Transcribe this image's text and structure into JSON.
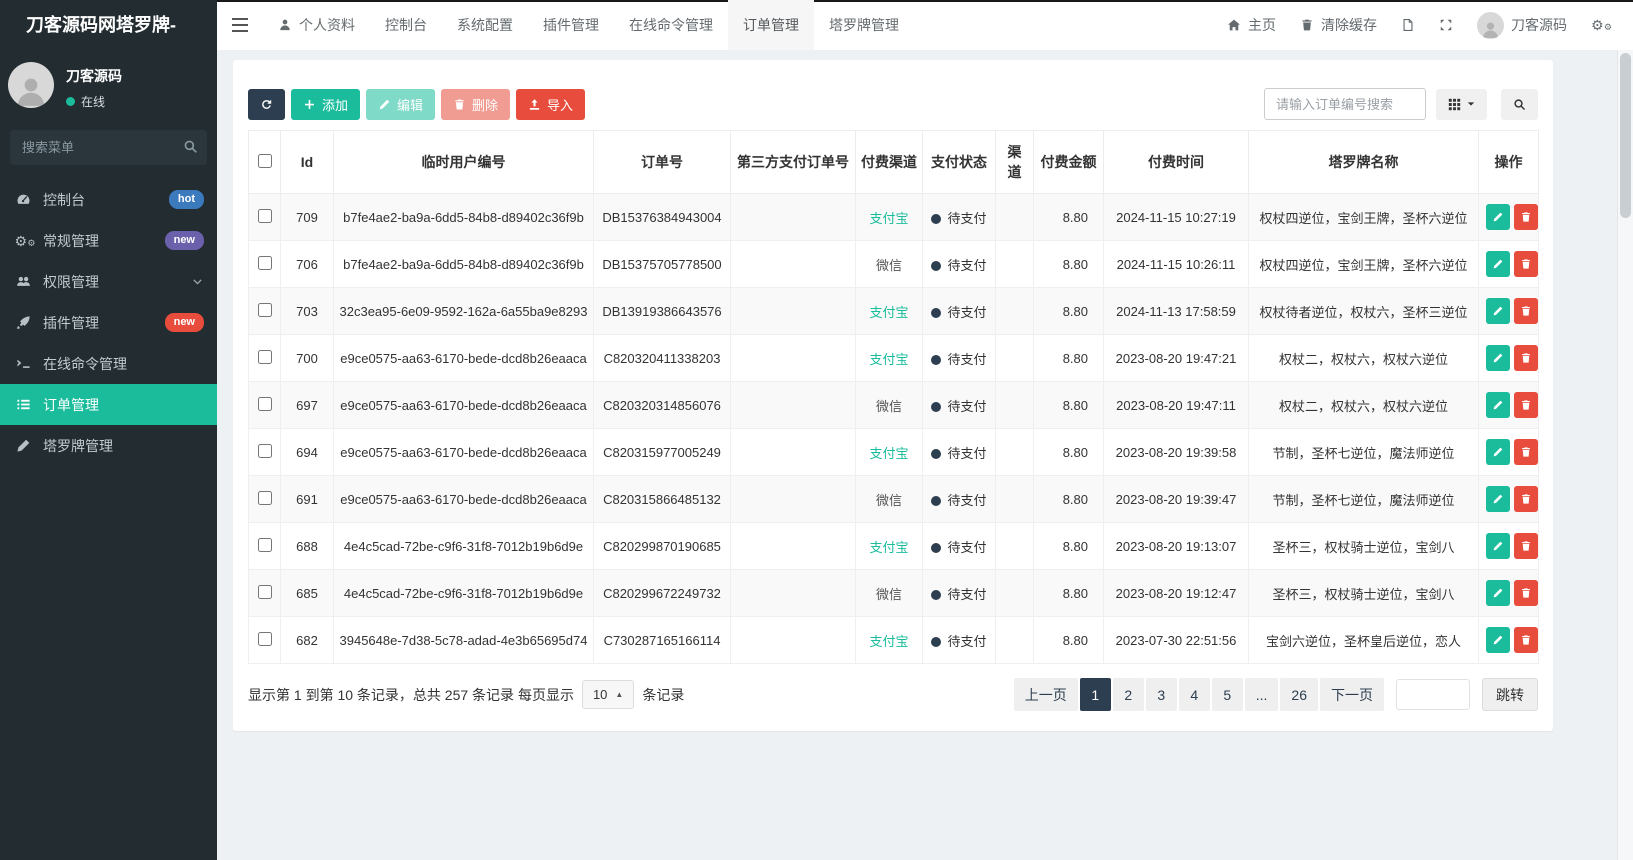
{
  "sidebar": {
    "brand": "刀客源码网塔罗牌-",
    "user": {
      "name": "刀客源码",
      "status": "在线"
    },
    "search_placeholder": "搜索菜单",
    "accent_color": "#1abc9c",
    "items": [
      {
        "label": "控制台",
        "icon": "dashboard-icon",
        "badge": "hot",
        "badge_color": "#3a7abd"
      },
      {
        "label": "常规管理",
        "icon": "gears-icon",
        "badge": "new",
        "badge_color": "#6b60ab"
      },
      {
        "label": "权限管理",
        "icon": "users-icon",
        "chevron": true
      },
      {
        "label": "插件管理",
        "icon": "rocket-icon",
        "badge": "new",
        "badge_color": "#e74c3c"
      },
      {
        "label": "在线命令管理",
        "icon": "terminal-icon"
      },
      {
        "label": "订单管理",
        "icon": "list-icon",
        "active": true
      },
      {
        "label": "塔罗牌管理",
        "icon": "pen-icon"
      }
    ]
  },
  "topnav": {
    "items": [
      {
        "label": "个人资料",
        "icon": "person-icon"
      },
      {
        "label": "控制台"
      },
      {
        "label": "系统配置"
      },
      {
        "label": "插件管理"
      },
      {
        "label": "在线命令管理"
      },
      {
        "label": "订单管理",
        "active": true
      },
      {
        "label": "塔罗牌管理"
      }
    ],
    "right": {
      "home": "主页",
      "clear_cache": "清除缓存",
      "username": "刀客源码"
    }
  },
  "toolbar": {
    "add_label": "添加",
    "edit_label": "编辑",
    "delete_label": "删除",
    "import_label": "导入",
    "search_placeholder": "请输入订单编号搜索"
  },
  "table": {
    "columns": [
      "Id",
      "临时用户编号",
      "订单号",
      "第三方支付订单号",
      "付费渠道",
      "支付状态",
      "渠道",
      "付费金额",
      "付费时间",
      "塔罗牌名称",
      "操作"
    ],
    "channel_colors": {
      "支付宝": "#1abc9c",
      "微信": "#555555"
    },
    "status_dot_color": "#2c3e50",
    "rows": [
      {
        "id": "709",
        "user_no": "b7fe4ae2-ba9a-6dd5-84b8-d89402c36f9b",
        "order_no": "DB15376384943004",
        "third_party_no": "",
        "channel": "支付宝",
        "status": "待支付",
        "qudao": "",
        "amount": "8.80",
        "time": "2024-11-15 10:27:19",
        "tarot": "权杖四逆位，宝剑王牌，圣杯六逆位"
      },
      {
        "id": "706",
        "user_no": "b7fe4ae2-ba9a-6dd5-84b8-d89402c36f9b",
        "order_no": "DB15375705778500",
        "third_party_no": "",
        "channel": "微信",
        "status": "待支付",
        "qudao": "",
        "amount": "8.80",
        "time": "2024-11-15 10:26:11",
        "tarot": "权杖四逆位，宝剑王牌，圣杯六逆位"
      },
      {
        "id": "703",
        "user_no": "32c3ea95-6e09-9592-162a-6a55ba9e8293",
        "order_no": "DB13919386643576",
        "third_party_no": "",
        "channel": "支付宝",
        "status": "待支付",
        "qudao": "",
        "amount": "8.80",
        "time": "2024-11-13 17:58:59",
        "tarot": "权杖待者逆位，权杖六，圣杯三逆位"
      },
      {
        "id": "700",
        "user_no": "e9ce0575-aa63-6170-bede-dcd8b26eaaca",
        "order_no": "C820320411338203",
        "third_party_no": "",
        "channel": "支付宝",
        "status": "待支付",
        "qudao": "",
        "amount": "8.80",
        "time": "2023-08-20 19:47:21",
        "tarot": "权杖二，权杖六，权杖六逆位"
      },
      {
        "id": "697",
        "user_no": "e9ce0575-aa63-6170-bede-dcd8b26eaaca",
        "order_no": "C820320314856076",
        "third_party_no": "",
        "channel": "微信",
        "status": "待支付",
        "qudao": "",
        "amount": "8.80",
        "time": "2023-08-20 19:47:11",
        "tarot": "权杖二，权杖六，权杖六逆位"
      },
      {
        "id": "694",
        "user_no": "e9ce0575-aa63-6170-bede-dcd8b26eaaca",
        "order_no": "C820315977005249",
        "third_party_no": "",
        "channel": "支付宝",
        "status": "待支付",
        "qudao": "",
        "amount": "8.80",
        "time": "2023-08-20 19:39:58",
        "tarot": "节制，圣杯七逆位，魔法师逆位"
      },
      {
        "id": "691",
        "user_no": "e9ce0575-aa63-6170-bede-dcd8b26eaaca",
        "order_no": "C820315866485132",
        "third_party_no": "",
        "channel": "微信",
        "status": "待支付",
        "qudao": "",
        "amount": "8.80",
        "time": "2023-08-20 19:39:47",
        "tarot": "节制，圣杯七逆位，魔法师逆位"
      },
      {
        "id": "688",
        "user_no": "4e4c5cad-72be-c9f6-31f8-7012b19b6d9e",
        "order_no": "C820299870190685",
        "third_party_no": "",
        "channel": "支付宝",
        "status": "待支付",
        "qudao": "",
        "amount": "8.80",
        "time": "2023-08-20 19:13:07",
        "tarot": "圣杯三，权杖骑士逆位，宝剑八"
      },
      {
        "id": "685",
        "user_no": "4e4c5cad-72be-c9f6-31f8-7012b19b6d9e",
        "order_no": "C820299672249732",
        "third_party_no": "",
        "channel": "微信",
        "status": "待支付",
        "qudao": "",
        "amount": "8.80",
        "time": "2023-08-20 19:12:47",
        "tarot": "圣杯三，权杖骑士逆位，宝剑八"
      },
      {
        "id": "682",
        "user_no": "3945648e-7d38-5c78-adad-4e3b65695d74",
        "order_no": "C730287165166114",
        "third_party_no": "",
        "channel": "支付宝",
        "status": "待支付",
        "qudao": "",
        "amount": "8.80",
        "time": "2023-07-30 22:51:56",
        "tarot": "宝剑六逆位，圣杯皇后逆位，恋人"
      }
    ]
  },
  "pagination": {
    "info_prefix": "显示第 1 到第 10 条记录，总共 257 条记录 每页显示",
    "per_page": "10",
    "info_suffix": "条记录",
    "pages": [
      "上一页",
      "1",
      "2",
      "3",
      "4",
      "5",
      "...",
      "26",
      "下一页"
    ],
    "active_page": "1",
    "jump_label": "跳转"
  }
}
